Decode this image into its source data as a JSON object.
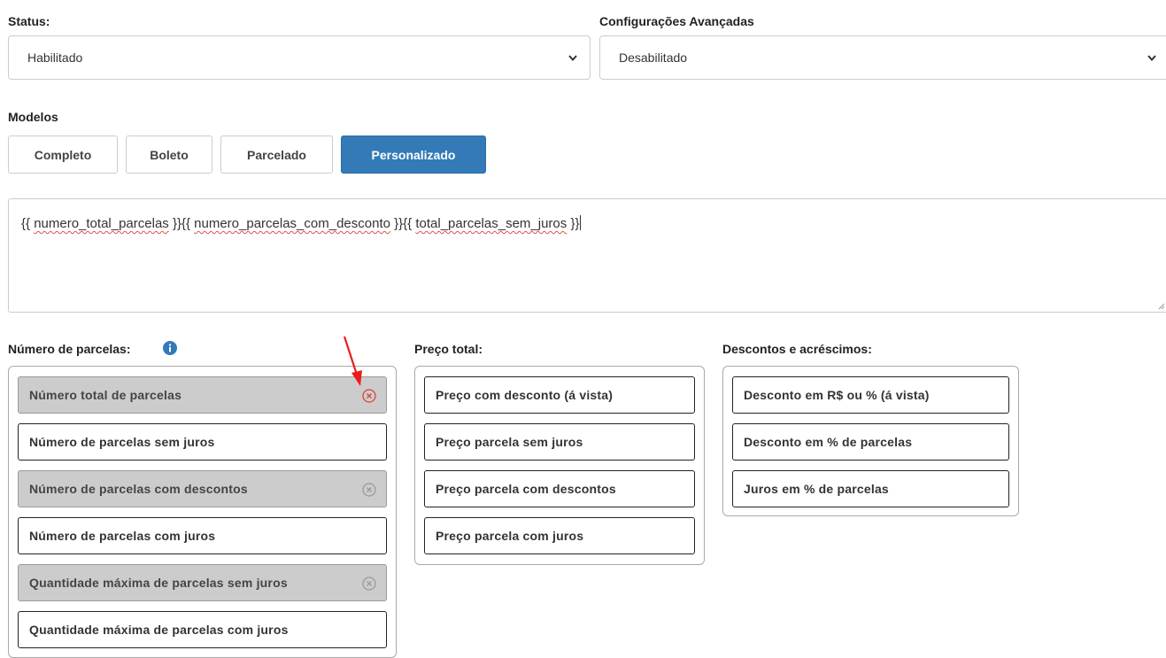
{
  "status": {
    "label": "Status:",
    "value": "Habilitado"
  },
  "advanced": {
    "label": "Configurações Avançadas",
    "value": "Desabilitado"
  },
  "models": {
    "label": "Modelos",
    "buttons": [
      "Completo",
      "Boleto",
      "Parcelado",
      "Personalizado"
    ],
    "active": "Personalizado"
  },
  "template_text": {
    "t0": "{{ ",
    "v1": "numero_total_parcelas",
    "t1": " }}{{ ",
    "v2": "numero_parcelas_com_desconto",
    "t2": " }}{{ ",
    "v3": "total_parcelas_sem_juros",
    "t3": " }}"
  },
  "installments": {
    "label": "Número de parcelas:",
    "items": [
      "Número total de parcelas",
      "Número de parcelas sem juros",
      "Número de parcelas com descontos",
      "Número de parcelas com juros",
      "Quantidade máxima de parcelas sem juros",
      "Quantidade máxima de parcelas com juros"
    ],
    "selected": [
      0,
      2,
      4
    ]
  },
  "total_price": {
    "label": "Preço total:",
    "items": [
      "Preço com desconto (á vista)",
      "Preço parcela sem juros",
      "Preço parcela com descontos",
      "Preço parcela com juros"
    ]
  },
  "discounts": {
    "label": "Descontos e acréscimos:",
    "items": [
      "Desconto em R$ ou % (á vista)",
      "Desconto em % de parcelas",
      "Juros em % de parcelas"
    ]
  },
  "colors": {
    "primary": "#337ab7",
    "selected_bg": "#cccccc",
    "remove_highlight": "#e0403a",
    "annotation_arrow": "#ee1b1b"
  },
  "icons": {
    "select_caret": "chevron-down-icon",
    "info": "info-circle-icon",
    "remove": "close-circle-icon"
  }
}
